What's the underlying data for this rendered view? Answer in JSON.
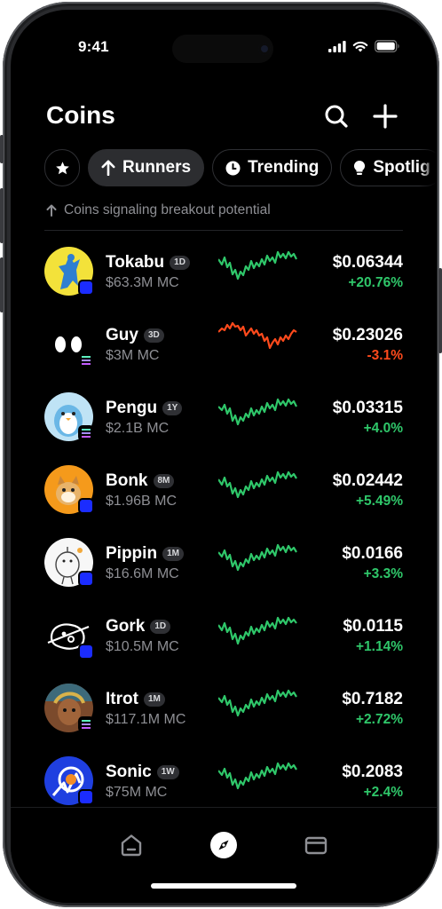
{
  "status": {
    "time": "9:41"
  },
  "header": {
    "title": "Coins"
  },
  "filters": [
    {
      "label": "",
      "icon": "star-icon"
    },
    {
      "label": "Runners",
      "icon": "arrow-up-icon",
      "active": true
    },
    {
      "label": "Trending",
      "icon": "clock-icon"
    },
    {
      "label": "Spotlig",
      "icon": "bulb-icon"
    }
  ],
  "subtitle": "Coins signaling breakout potential",
  "coins": [
    {
      "name": "Tokabu",
      "age": "1D",
      "mc": "$63.3M MC",
      "price": "$0.06344",
      "change": "+20.76%",
      "trend": "up",
      "chain": "base",
      "avatar_bg": "#f3e23a"
    },
    {
      "name": "Guy",
      "age": "3D",
      "mc": "$3M MC",
      "price": "$0.23026",
      "change": "-3.1%",
      "trend": "down",
      "chain": "solana",
      "avatar_bg": "#000000"
    },
    {
      "name": "Pengu",
      "age": "1Y",
      "mc": "$2.1B MC",
      "price": "$0.03315",
      "change": "+4.0%",
      "trend": "up",
      "chain": "solana",
      "avatar_bg": "#bfe3f5"
    },
    {
      "name": "Bonk",
      "age": "8M",
      "mc": "$1.96B MC",
      "price": "$0.02442",
      "change": "+5.49%",
      "trend": "up",
      "chain": "base",
      "avatar_bg": "#f59a1b"
    },
    {
      "name": "Pippin",
      "age": "1M",
      "mc": "$16.6M MC",
      "price": "$0.0166",
      "change": "+3.3%",
      "trend": "up",
      "chain": "base",
      "avatar_bg": "#f7f7f7"
    },
    {
      "name": "Gork",
      "age": "1D",
      "mc": "$10.5M MC",
      "price": "$0.0115",
      "change": "+1.14%",
      "trend": "up",
      "chain": "base",
      "avatar_bg": "#000000"
    },
    {
      "name": "Itrot",
      "age": "1M",
      "mc": "$117.1M MC",
      "price": "$0.7182",
      "change": "+2.72%",
      "trend": "up",
      "chain": "solana",
      "avatar_bg": "#7b4a2c"
    },
    {
      "name": "Sonic",
      "age": "1W",
      "mc": "$75M MC",
      "price": "$0.2083",
      "change": "+2.4%",
      "trend": "up",
      "chain": "base",
      "avatar_bg": "#1f3fe0"
    }
  ],
  "tabs": [
    {
      "icon": "home-icon"
    },
    {
      "icon": "compass-icon",
      "active": true
    },
    {
      "icon": "wallet-icon"
    }
  ],
  "colors": {
    "up": "#2fc76a",
    "down": "#ff4a1c",
    "base_badge": "#1b2cff",
    "chip_active": "#2c2d30"
  }
}
